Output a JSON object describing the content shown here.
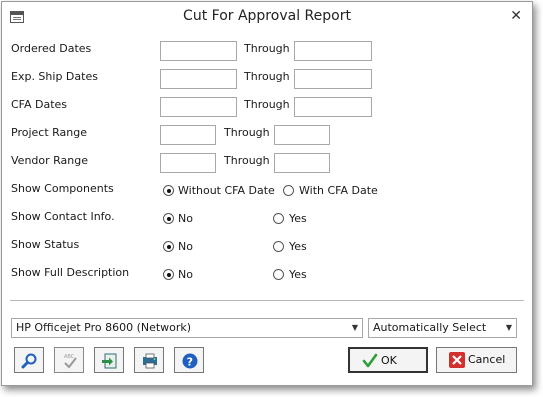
{
  "window": {
    "title": "Cut For Approval Report"
  },
  "rows": [
    {
      "label": "Ordered Dates",
      "through": "Through",
      "from": "",
      "to": ""
    },
    {
      "label": "Exp. Ship Dates",
      "through": "Through",
      "from": "",
      "to": ""
    },
    {
      "label": "CFA Dates",
      "through": "Through",
      "from": "",
      "to": ""
    },
    {
      "label": "Project Range",
      "through": "Through",
      "from": "",
      "to": ""
    },
    {
      "label": "Vendor Range",
      "through": "Through",
      "from": "",
      "to": ""
    }
  ],
  "options": [
    {
      "label": "Show Components",
      "a": "Without CFA Date",
      "b": "With CFA Date",
      "selected": "a"
    },
    {
      "label": "Show Contact Info.",
      "a": "No",
      "b": "Yes",
      "selected": "a"
    },
    {
      "label": "Show Status",
      "a": "No",
      "b": "Yes",
      "selected": "a"
    },
    {
      "label": "Show Full Description",
      "a": "No",
      "b": "Yes",
      "selected": "a"
    }
  ],
  "printer": {
    "name": "HP Officejet Pro 8600 (Network)",
    "tray": "Automatically Select"
  },
  "toolbar": {
    "preview": "magnifier-icon",
    "spell": "spellcheck-icon",
    "export": "export-icon",
    "print": "print-icon",
    "help": "help-icon"
  },
  "buttons": {
    "ok": "OK",
    "cancel": "Cancel"
  },
  "colors": {
    "ok_check": "#2e9e3a",
    "cancel_x": "#d0312d",
    "help_blue": "#1f5fbf"
  }
}
